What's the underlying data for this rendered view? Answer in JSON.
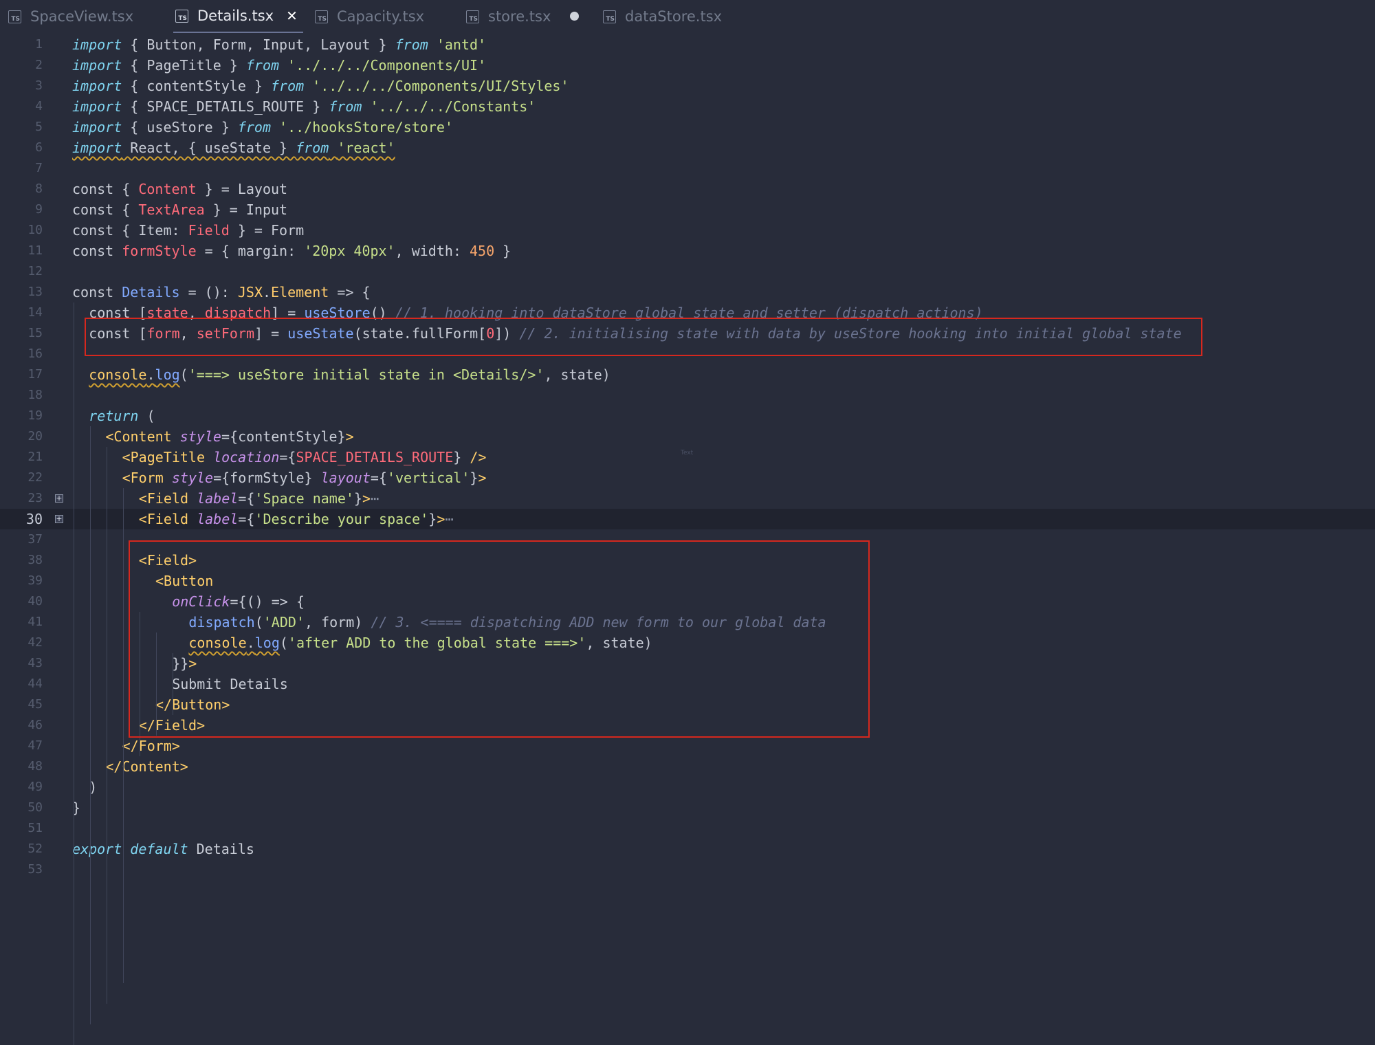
{
  "tabs": [
    {
      "label": "SpaceView.tsx",
      "icon": "ts-file-icon",
      "active": false
    },
    {
      "label": "Details.tsx",
      "icon": "ts-file-icon",
      "active": true,
      "close": "✕"
    },
    {
      "label": "Capacity.tsx",
      "icon": "ts-file-icon",
      "active": false
    },
    {
      "label": "store.tsx",
      "icon": "ts-file-icon",
      "active": false,
      "modified": true
    },
    {
      "label": "dataStore.tsx",
      "icon": "ts-file-icon",
      "active": false
    }
  ],
  "ts_badge": "TS",
  "lines": [
    {
      "n": "1",
      "segs": [
        [
          "kw",
          "import"
        ],
        [
          "pn",
          " { Button, Form, Input, Layout } "
        ],
        [
          "kw",
          "from"
        ],
        [
          "pn",
          " "
        ],
        [
          "str",
          "'antd'"
        ]
      ]
    },
    {
      "n": "2",
      "segs": [
        [
          "kw",
          "import"
        ],
        [
          "pn",
          " { PageTitle } "
        ],
        [
          "kw",
          "from"
        ],
        [
          "pn",
          " "
        ],
        [
          "str",
          "'../../../Components/UI'"
        ]
      ]
    },
    {
      "n": "3",
      "segs": [
        [
          "kw",
          "import"
        ],
        [
          "pn",
          " { contentStyle } "
        ],
        [
          "kw",
          "from"
        ],
        [
          "pn",
          " "
        ],
        [
          "str",
          "'../../../Components/UI/Styles'"
        ]
      ]
    },
    {
      "n": "4",
      "segs": [
        [
          "kw",
          "import"
        ],
        [
          "pn",
          " { SPACE_DETAILS_ROUTE } "
        ],
        [
          "kw",
          "from"
        ],
        [
          "pn",
          " "
        ],
        [
          "str",
          "'../../../Constants'"
        ]
      ]
    },
    {
      "n": "5",
      "segs": [
        [
          "kw",
          "import"
        ],
        [
          "pn",
          " { useStore } "
        ],
        [
          "kw",
          "from"
        ],
        [
          "pn",
          " "
        ],
        [
          "str",
          "'../hooksStore/store'"
        ]
      ]
    },
    {
      "n": "6",
      "squiggle": true,
      "segs": [
        [
          "kw",
          "import"
        ],
        [
          "pn",
          " React, { useState } "
        ],
        [
          "kw",
          "from"
        ],
        [
          "pn",
          " "
        ],
        [
          "str",
          "'react'"
        ]
      ]
    },
    {
      "n": "7",
      "segs": []
    },
    {
      "n": "8",
      "segs": [
        [
          "kwp",
          "const"
        ],
        [
          "pn",
          " { "
        ],
        [
          "var",
          "Content"
        ],
        [
          "pn",
          " } = Layout"
        ]
      ]
    },
    {
      "n": "9",
      "segs": [
        [
          "kwp",
          "const"
        ],
        [
          "pn",
          " { "
        ],
        [
          "var",
          "TextArea"
        ],
        [
          "pn",
          " } = Input"
        ]
      ]
    },
    {
      "n": "10",
      "segs": [
        [
          "kwp",
          "const"
        ],
        [
          "pn",
          " { Item: "
        ],
        [
          "var",
          "Field"
        ],
        [
          "pn",
          " } = Form"
        ]
      ]
    },
    {
      "n": "11",
      "segs": [
        [
          "kwp",
          "const"
        ],
        [
          "pn",
          " "
        ],
        [
          "var",
          "formStyle"
        ],
        [
          "pn",
          " = { margin: "
        ],
        [
          "str",
          "'20px 40px'"
        ],
        [
          "pn",
          ", width: "
        ],
        [
          "num",
          "450"
        ],
        [
          "pn",
          " }"
        ]
      ]
    },
    {
      "n": "12",
      "segs": []
    },
    {
      "n": "13",
      "segs": [
        [
          "kwp",
          "const"
        ],
        [
          "pn",
          " "
        ],
        [
          "fn",
          "Details"
        ],
        [
          "pn",
          " = (): "
        ],
        [
          "ty",
          "JSX"
        ],
        [
          "pn",
          "."
        ],
        [
          "ty",
          "Element"
        ],
        [
          "pn",
          " => {"
        ]
      ]
    },
    {
      "n": "14",
      "indent": 1,
      "segs": [
        [
          "kwp",
          "const"
        ],
        [
          "pn",
          " ["
        ],
        [
          "var",
          "state"
        ],
        [
          "pn",
          ", "
        ],
        [
          "var",
          "dispatch"
        ],
        [
          "pn",
          "] = "
        ],
        [
          "fn",
          "useStore"
        ],
        [
          "pn",
          "() "
        ],
        [
          "cm",
          "// 1. hooking into dataStore global state and setter (dispatch actions)"
        ]
      ]
    },
    {
      "n": "15",
      "indent": 1,
      "segs": [
        [
          "kwp",
          "const"
        ],
        [
          "pn",
          " ["
        ],
        [
          "var",
          "form"
        ],
        [
          "pn",
          ", "
        ],
        [
          "var",
          "setForm"
        ],
        [
          "pn",
          "] = "
        ],
        [
          "fn",
          "useState"
        ],
        [
          "pn",
          "(state.fullForm["
        ],
        [
          "var",
          "0"
        ],
        [
          "pn",
          "]) "
        ],
        [
          "cm",
          "// 2. initialising state with data by useStore hooking into initial global state"
        ]
      ]
    },
    {
      "n": "16",
      "indent": 1,
      "segs": []
    },
    {
      "n": "17",
      "indent": 1,
      "segs": [
        [
          "tag sq",
          "console"
        ],
        [
          "pn sq",
          "."
        ],
        [
          "fn sq",
          "log"
        ],
        [
          "pn",
          "("
        ],
        [
          "str",
          "'===> useStore initial state in <Details/>'"
        ],
        [
          "pn",
          ", state)"
        ]
      ]
    },
    {
      "n": "18",
      "indent": 1,
      "segs": []
    },
    {
      "n": "19",
      "indent": 1,
      "segs": [
        [
          "kw",
          "return"
        ],
        [
          "pn",
          " ("
        ]
      ]
    },
    {
      "n": "20",
      "indent": 2,
      "segs": [
        [
          "tag",
          "<Content"
        ],
        [
          "pn",
          " "
        ],
        [
          "attr",
          "style"
        ],
        [
          "pn",
          "={contentStyle}"
        ],
        [
          "tag",
          ">"
        ]
      ]
    },
    {
      "n": "21",
      "indent": 3,
      "segs": [
        [
          "tag",
          "<PageTitle"
        ],
        [
          "pn",
          " "
        ],
        [
          "attr",
          "location"
        ],
        [
          "pn",
          "={"
        ],
        [
          "var",
          "SPACE_DETAILS_ROUTE"
        ],
        [
          "pn",
          "} "
        ],
        [
          "tag",
          "/>"
        ]
      ]
    },
    {
      "n": "22",
      "indent": 3,
      "segs": [
        [
          "tag",
          "<Form"
        ],
        [
          "pn",
          " "
        ],
        [
          "attr",
          "style"
        ],
        [
          "pn",
          "={formStyle} "
        ],
        [
          "attr",
          "layout"
        ],
        [
          "pn",
          "={"
        ],
        [
          "str",
          "'vertical'"
        ],
        [
          "pn",
          "}"
        ],
        [
          "tag",
          ">"
        ]
      ]
    },
    {
      "n": "23",
      "indent": 4,
      "fold": true,
      "segs": [
        [
          "tag",
          "<Field"
        ],
        [
          "pn",
          " "
        ],
        [
          "attr",
          "label"
        ],
        [
          "pn",
          "={"
        ],
        [
          "str",
          "'Space name'"
        ],
        [
          "pn",
          "}"
        ],
        [
          "tag",
          ">"
        ],
        [
          "ell",
          "⋯"
        ]
      ]
    },
    {
      "n": "30",
      "indent": 4,
      "fold": true,
      "current": true,
      "segs": [
        [
          "tag",
          "<Field"
        ],
        [
          "pn",
          " "
        ],
        [
          "attr",
          "label"
        ],
        [
          "pn",
          "={"
        ],
        [
          "str",
          "'Describe your space'"
        ],
        [
          "pn",
          "}"
        ],
        [
          "tag",
          ">"
        ],
        [
          "ell",
          "⋯"
        ]
      ]
    },
    {
      "n": "37",
      "indent": 4,
      "segs": []
    },
    {
      "n": "38",
      "indent": 4,
      "segs": [
        [
          "tag",
          "<Field>"
        ]
      ]
    },
    {
      "n": "39",
      "indent": 5,
      "segs": [
        [
          "tag",
          "<Button"
        ]
      ]
    },
    {
      "n": "40",
      "indent": 6,
      "segs": [
        [
          "attr",
          "onClick"
        ],
        [
          "pn",
          "={() => {"
        ]
      ]
    },
    {
      "n": "41",
      "indent": 7,
      "segs": [
        [
          "fn",
          "dispatch"
        ],
        [
          "pn",
          "("
        ],
        [
          "str",
          "'ADD'"
        ],
        [
          "pn",
          ", form) "
        ],
        [
          "cm",
          "// 3. <==== dispatching ADD new form to our global data"
        ]
      ]
    },
    {
      "n": "42",
      "indent": 7,
      "segs": [
        [
          "tag sq",
          "console"
        ],
        [
          "pn sq",
          "."
        ],
        [
          "fn sq",
          "log"
        ],
        [
          "pn",
          "("
        ],
        [
          "str",
          "'after ADD to the global state ===>'"
        ],
        [
          "pn",
          ", state)"
        ]
      ]
    },
    {
      "n": "43",
      "indent": 6,
      "segs": [
        [
          "pn",
          "}}"
        ],
        [
          "tag",
          ">"
        ]
      ]
    },
    {
      "n": "44",
      "indent": 6,
      "segs": [
        [
          "pn",
          "Submit Details"
        ]
      ]
    },
    {
      "n": "45",
      "indent": 5,
      "segs": [
        [
          "tag",
          "</Button>"
        ]
      ]
    },
    {
      "n": "46",
      "indent": 4,
      "segs": [
        [
          "tag",
          "</Field>"
        ]
      ]
    },
    {
      "n": "47",
      "indent": 3,
      "segs": [
        [
          "tag",
          "</Form>"
        ]
      ]
    },
    {
      "n": "48",
      "indent": 2,
      "segs": [
        [
          "tag",
          "</Content>"
        ]
      ]
    },
    {
      "n": "49",
      "indent": 1,
      "segs": [
        [
          "pn",
          ")"
        ]
      ]
    },
    {
      "n": "50",
      "segs": [
        [
          "pn",
          "}"
        ]
      ]
    },
    {
      "n": "51",
      "segs": []
    },
    {
      "n": "52",
      "segs": [
        [
          "kw",
          "export"
        ],
        [
          "pn",
          " "
        ],
        [
          "kw",
          "default"
        ],
        [
          "pn",
          " Details"
        ]
      ]
    },
    {
      "n": "53",
      "segs": []
    }
  ],
  "overlay_text": "Text"
}
